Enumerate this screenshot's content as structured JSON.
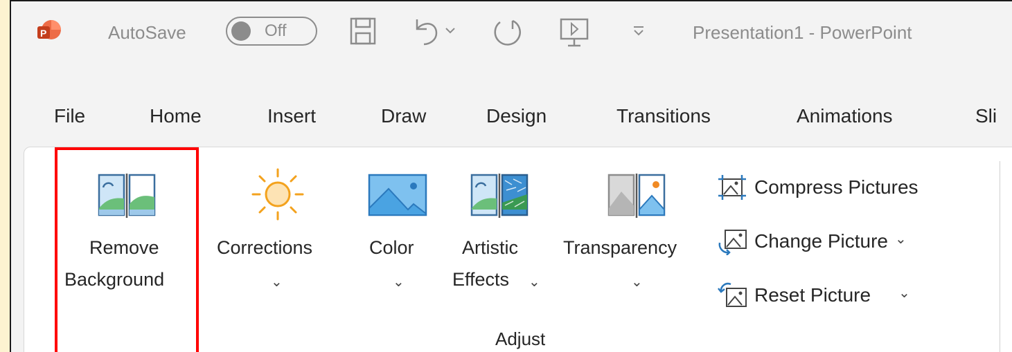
{
  "titlebar": {
    "autosave_label": "AutoSave",
    "autosave_state": "Off",
    "document_title": "Presentation1  -  PowerPoint"
  },
  "tabs": [
    "File",
    "Home",
    "Insert",
    "Draw",
    "Design",
    "Transitions",
    "Animations",
    "Sli"
  ],
  "ribbon": {
    "remove_background": {
      "line1": "Remove",
      "line2": "Background"
    },
    "corrections": {
      "label": "Corrections",
      "chevron": "⌄"
    },
    "color": {
      "label": "Color",
      "chevron": "⌄"
    },
    "artistic_effects": {
      "line1": "Artistic",
      "line2": "Effects",
      "chevron": "⌄"
    },
    "transparency": {
      "label": "Transparency",
      "chevron": "⌄"
    },
    "compress_pictures": "Compress Pictures",
    "change_picture": "Change Picture",
    "change_picture_chevron": "⌄",
    "reset_picture": "Reset Picture",
    "reset_picture_chevron": "⌄",
    "group_label": "Adjust"
  },
  "colors": {
    "accent_red": "#ff0000",
    "powerpoint_orange": "#d35230",
    "background_frame": "#fdf3d1"
  },
  "icons": [
    "powerpoint-logo-icon",
    "save-icon",
    "undo-icon",
    "dropdown-chevron-icon",
    "redo-icon",
    "present-from-start-icon",
    "customize-qat-icon",
    "remove-background-icon",
    "corrections-sun-icon",
    "color-picture-icon",
    "artistic-effects-icon",
    "transparency-icon",
    "compress-pictures-icon",
    "change-picture-icon",
    "reset-picture-icon"
  ]
}
